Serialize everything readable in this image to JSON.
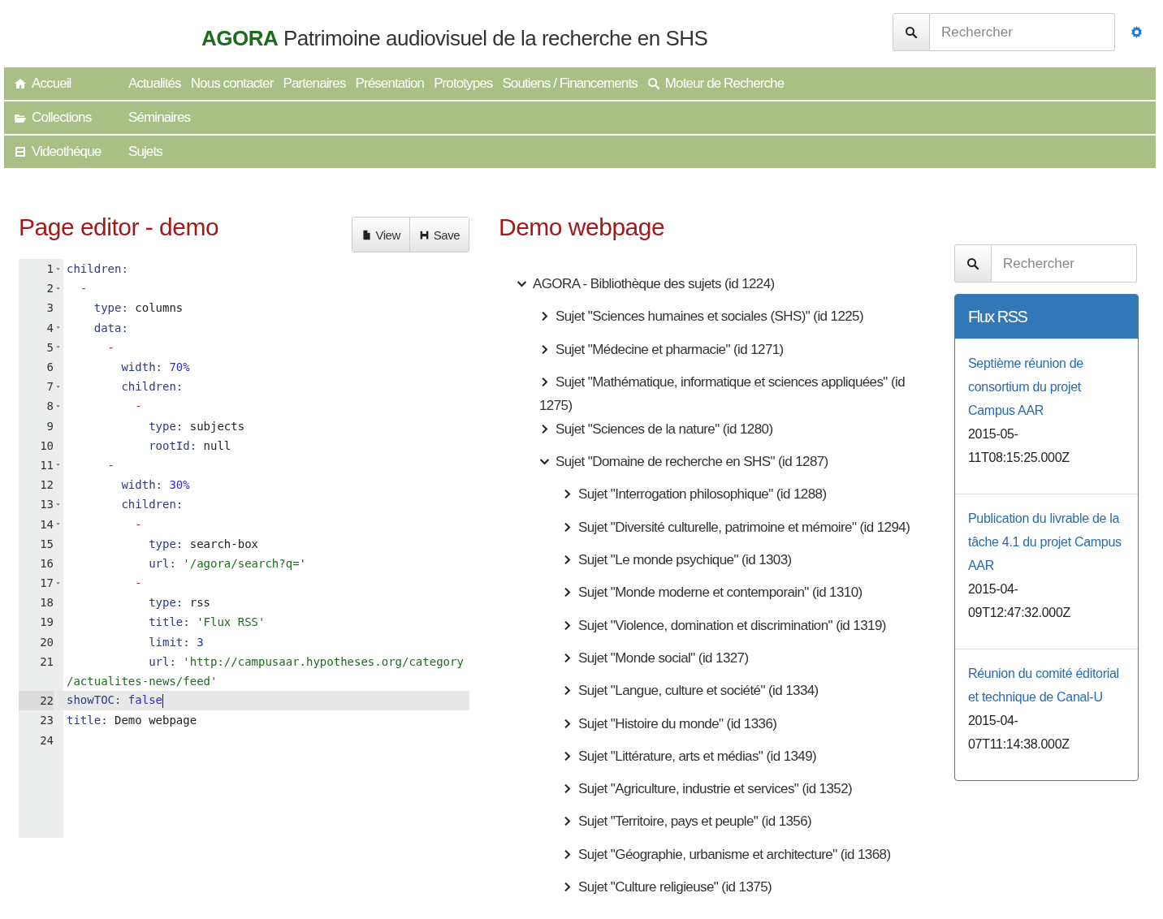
{
  "header": {
    "brand": "AGORA",
    "title": "Patrimoine audiovisuel de la recherche en SHS",
    "search": {
      "placeholder": "Rechercher"
    }
  },
  "nav_rows": [
    {
      "main": {
        "label": "Accueil"
      },
      "links": [
        {
          "label": "Actualités",
          "kind": "plain"
        },
        {
          "label": "Nous contacter",
          "kind": "plain"
        },
        {
          "label": "Partenaires",
          "kind": "plain"
        },
        {
          "label": "Présentation",
          "kind": "plain"
        },
        {
          "label": "Prototypes",
          "kind": "plain"
        },
        {
          "label": "Soutiens / Financements",
          "kind": "plain"
        },
        {
          "label": "Moteur de Recherche",
          "kind": "search"
        }
      ]
    },
    {
      "main": {
        "label": "Collections"
      },
      "links": [
        {
          "label": "Séminaires",
          "kind": "plain"
        }
      ]
    },
    {
      "main": {
        "label": "Videothéque"
      },
      "links": [
        {
          "label": "Sujets",
          "kind": "plain"
        }
      ]
    }
  ],
  "editor": {
    "title": "Page editor - demo",
    "buttons": [
      {
        "label": "View",
        "kind": "view"
      },
      {
        "label": "Save",
        "kind": "save"
      }
    ],
    "lines": [
      {
        "number": "1",
        "foldable": true,
        "active": false,
        "segments": [
          {
            "kind": "key",
            "text": "children:"
          }
        ]
      },
      {
        "number": "2",
        "foldable": true,
        "active": false,
        "segments": [
          {
            "kind": "dash",
            "text": "  -"
          }
        ]
      },
      {
        "number": "3",
        "foldable": false,
        "active": false,
        "segments": [
          {
            "kind": "key",
            "text": "    type:"
          },
          {
            "kind": "plain",
            "text": " columns"
          }
        ]
      },
      {
        "number": "4",
        "foldable": true,
        "active": false,
        "segments": [
          {
            "kind": "key",
            "text": "    data:"
          }
        ]
      },
      {
        "number": "5",
        "foldable": true,
        "active": false,
        "segments": [
          {
            "kind": "dash",
            "text": "      -"
          }
        ]
      },
      {
        "number": "6",
        "foldable": false,
        "active": false,
        "segments": [
          {
            "kind": "key",
            "text": "        width:"
          },
          {
            "kind": "number",
            "text": " 70%"
          }
        ]
      },
      {
        "number": "7",
        "foldable": true,
        "active": false,
        "segments": [
          {
            "kind": "key",
            "text": "        children:"
          }
        ]
      },
      {
        "number": "8",
        "foldable": true,
        "active": false,
        "segments": [
          {
            "kind": "dash",
            "text": "          -"
          }
        ]
      },
      {
        "number": "9",
        "foldable": false,
        "active": false,
        "segments": [
          {
            "kind": "key",
            "text": "            type:"
          },
          {
            "kind": "plain",
            "text": " subjects"
          }
        ]
      },
      {
        "number": "10",
        "foldable": false,
        "active": false,
        "segments": [
          {
            "kind": "key",
            "text": "            rootId:"
          },
          {
            "kind": "plain",
            "text": " null"
          }
        ]
      },
      {
        "number": "11",
        "foldable": true,
        "active": false,
        "segments": [
          {
            "kind": "dash",
            "text": "      -"
          }
        ]
      },
      {
        "number": "12",
        "foldable": false,
        "active": false,
        "segments": [
          {
            "kind": "key",
            "text": "        width:"
          },
          {
            "kind": "number",
            "text": " 30%"
          }
        ]
      },
      {
        "number": "13",
        "foldable": true,
        "active": false,
        "segments": [
          {
            "kind": "key",
            "text": "        children:"
          }
        ]
      },
      {
        "number": "14",
        "foldable": true,
        "active": false,
        "segments": [
          {
            "kind": "dash",
            "text": "          -"
          }
        ]
      },
      {
        "number": "15",
        "foldable": false,
        "active": false,
        "segments": [
          {
            "kind": "key",
            "text": "            type:"
          },
          {
            "kind": "plain",
            "text": " search-box"
          }
        ]
      },
      {
        "number": "16",
        "foldable": false,
        "active": false,
        "segments": [
          {
            "kind": "key",
            "text": "            url:"
          },
          {
            "kind": "string",
            "text": " '/agora/search?q='"
          }
        ]
      },
      {
        "number": "17",
        "foldable": true,
        "active": false,
        "segments": [
          {
            "kind": "dash",
            "text": "          -"
          }
        ]
      },
      {
        "number": "18",
        "foldable": false,
        "active": false,
        "segments": [
          {
            "kind": "key",
            "text": "            type:"
          },
          {
            "kind": "plain",
            "text": " rss"
          }
        ]
      },
      {
        "number": "19",
        "foldable": false,
        "active": false,
        "segments": [
          {
            "kind": "key",
            "text": "            title:"
          },
          {
            "kind": "string",
            "text": " 'Flux RSS'"
          }
        ]
      },
      {
        "number": "20",
        "foldable": false,
        "active": false,
        "segments": [
          {
            "kind": "key",
            "text": "            limit:"
          },
          {
            "kind": "number",
            "text": " 3"
          }
        ]
      },
      {
        "number": "21",
        "foldable": false,
        "active": false,
        "segments": [
          {
            "kind": "key",
            "text": "            url:"
          },
          {
            "kind": "string",
            "text": " 'http://campusaar.hypotheses.org/category"
          }
        ],
        "continuation": "/actualites-news/feed'"
      },
      {
        "number": "22",
        "foldable": false,
        "active": true,
        "segments": [
          {
            "kind": "key",
            "text": "showTOC:"
          },
          {
            "kind": "number",
            "text": " false"
          }
        ]
      },
      {
        "number": "23",
        "foldable": false,
        "active": false,
        "segments": [
          {
            "kind": "key",
            "text": "title:"
          },
          {
            "kind": "plain",
            "text": " Demo webpage"
          }
        ]
      },
      {
        "number": "24",
        "foldable": false,
        "active": false
      }
    ]
  },
  "demo": {
    "title": "Demo webpage",
    "tree": [
      {
        "label": "AGORA - Bibliothèque des sujets (id 1224)",
        "expanded": true,
        "children": [
          {
            "label": "Sujet \"Sciences humaines et sociales (SHS)\" (id 1225)",
            "expanded": false
          },
          {
            "label": "Sujet \"Médecine et pharmacie\" (id 1271)",
            "expanded": false
          },
          {
            "label": "Sujet \"Mathématique, informatique et sciences appliquées\" (id 1275)",
            "expanded": false
          },
          {
            "label": "Sujet \"Sciences de la nature\" (id 1280)",
            "expanded": false
          },
          {
            "label": "Sujet \"Domaine de recherche en SHS\" (id 1287)",
            "expanded": true,
            "children": [
              {
                "label": "Sujet \"Interrogation philosophique\" (id 1288)",
                "expanded": false
              },
              {
                "label": "Sujet \"Diversité culturelle, patrimoine et mémoire\" (id 1294)",
                "expanded": false
              },
              {
                "label": "Sujet \"Le monde psychique\" (id 1303)",
                "expanded": false
              },
              {
                "label": "Sujet \"Monde moderne et contemporain\" (id 1310)",
                "expanded": false
              },
              {
                "label": "Sujet \"Violence, domination et discrimination\" (id 1319)",
                "expanded": false
              },
              {
                "label": "Sujet \"Monde social\" (id 1327)",
                "expanded": false
              },
              {
                "label": "Sujet \"Langue, culture et société\" (id 1334)",
                "expanded": false
              },
              {
                "label": "Sujet \"Histoire du monde\" (id 1336)",
                "expanded": false
              },
              {
                "label": "Sujet \"Littérature, arts et médias\" (id 1349)",
                "expanded": false
              },
              {
                "label": "Sujet \"Agriculture, industrie et services\" (id 1352)",
                "expanded": false
              },
              {
                "label": "Sujet \"Territoire, pays et peuple\" (id 1356)",
                "expanded": false
              },
              {
                "label": "Sujet \"Géographie, urbanisme et architecture\" (id 1368)",
                "expanded": false
              },
              {
                "label": "Sujet \"Culture religieuse\" (id 1375)",
                "expanded": false
              }
            ]
          }
        ]
      }
    ],
    "search": {
      "placeholder": "Rechercher"
    },
    "rss": {
      "title": "Flux RSS",
      "items": [
        {
          "title": "Septième réunion de consortium du projet Campus AAR",
          "date": "2015-05-11T08:15:25.000Z"
        },
        {
          "title": "Publication du livrable de la tâche 4.1 du projet Campus AAR",
          "date": "2015-04-09T12:47:32.000Z"
        },
        {
          "title": "Réunion du comité éditorial et technique de Canal-U",
          "date": "2015-04-07T11:14:38.000Z"
        }
      ]
    }
  }
}
